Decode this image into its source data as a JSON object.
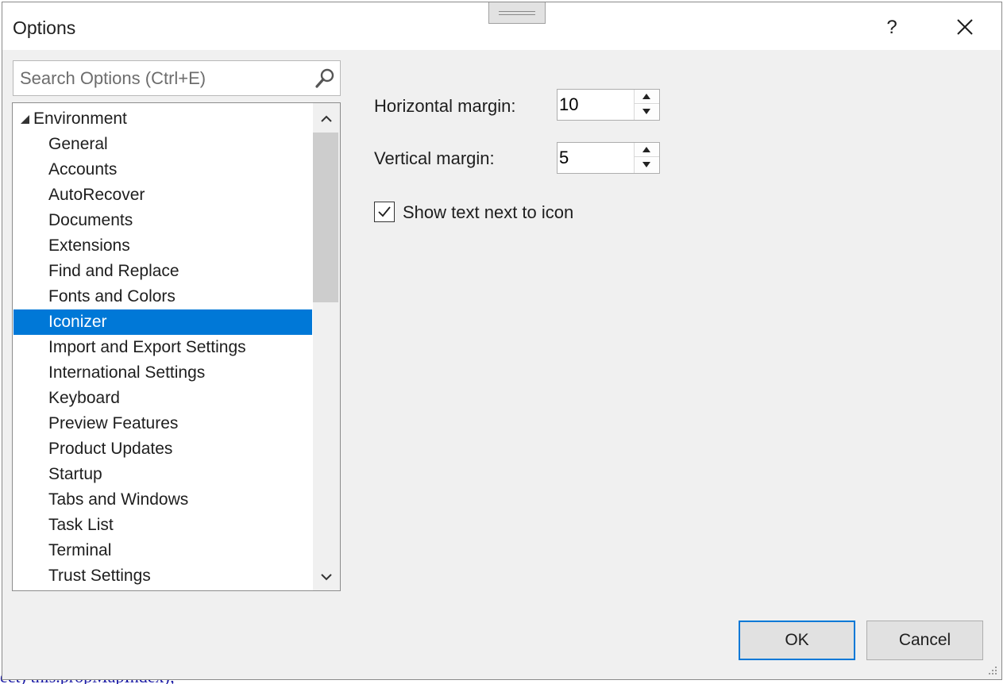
{
  "dialog": {
    "title": "Options",
    "help_label": "?"
  },
  "search": {
    "placeholder": "Search Options (Ctrl+E)"
  },
  "tree": {
    "root": "Environment",
    "items": [
      {
        "label": "General"
      },
      {
        "label": "Accounts"
      },
      {
        "label": "AutoRecover"
      },
      {
        "label": "Documents"
      },
      {
        "label": "Extensions"
      },
      {
        "label": "Find and Replace"
      },
      {
        "label": "Fonts and Colors"
      },
      {
        "label": "Iconizer"
      },
      {
        "label": "Import and Export Settings"
      },
      {
        "label": "International Settings"
      },
      {
        "label": "Keyboard"
      },
      {
        "label": "Preview Features"
      },
      {
        "label": "Product Updates"
      },
      {
        "label": "Startup"
      },
      {
        "label": "Tabs and Windows"
      },
      {
        "label": "Task List"
      },
      {
        "label": "Terminal"
      },
      {
        "label": "Trust Settings"
      }
    ],
    "selected": "Iconizer"
  },
  "settings": {
    "horizontal_margin_label": "Horizontal margin:",
    "horizontal_margin_value": "10",
    "vertical_margin_label": "Vertical margin:",
    "vertical_margin_value": "5",
    "show_text_label": "Show text next to icon",
    "show_text_checked": true
  },
  "buttons": {
    "ok": "OK",
    "cancel": "Cancel"
  },
  "background": {
    "code_fragment": "ect) this.propMapIndex);"
  },
  "colors": {
    "selection": "#0078d7",
    "dialog_bg": "#f0f0f0"
  }
}
